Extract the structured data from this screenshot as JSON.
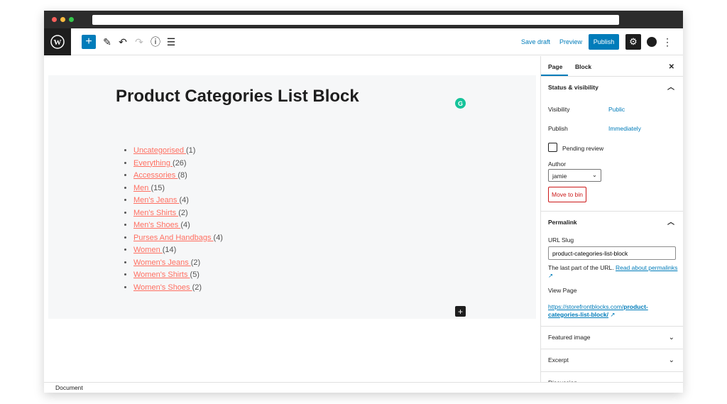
{
  "toolbar": {
    "save_draft": "Save draft",
    "preview": "Preview",
    "publish": "Publish"
  },
  "editor": {
    "title": "Product Categories List Block",
    "grammarly": "G",
    "categories": [
      {
        "name": "Uncategorised ",
        "count": "(1)"
      },
      {
        "name": "Everything ",
        "count": "(26)"
      },
      {
        "name": "Accessories ",
        "count": "(8)"
      },
      {
        "name": "Men ",
        "count": "(15)"
      },
      {
        "name": "Men's Jeans ",
        "count": "(4)"
      },
      {
        "name": "Men's Shirts ",
        "count": "(2)"
      },
      {
        "name": "Men's Shoes ",
        "count": "(4)"
      },
      {
        "name": "Purses And Handbags ",
        "count": "(4)"
      },
      {
        "name": "Women ",
        "count": "(14)"
      },
      {
        "name": "Women's Jeans ",
        "count": "(2)"
      },
      {
        "name": "Women's Shirts ",
        "count": "(5)"
      },
      {
        "name": "Women's Shoes ",
        "count": "(2)"
      }
    ]
  },
  "sidebar": {
    "tabs": [
      "Page",
      "Block"
    ],
    "status": {
      "title": "Status & visibility",
      "visibility_label": "Visibility",
      "visibility_value": "Public",
      "publish_label": "Publish",
      "publish_value": "Immediately",
      "pending": "Pending review",
      "author_label": "Author",
      "author_value": "jamie",
      "move_to_bin": "Move to bin"
    },
    "permalink": {
      "title": "Permalink",
      "slug_label": "URL Slug",
      "slug_value": "product-categories-list-block",
      "help": "The last part of the URL. ",
      "read_about": "Read about permalinks",
      "view_page": "View Page",
      "url_plain": "https://storefrontblocks.com/",
      "url_bold": "product-categories-list-block/"
    },
    "featured": "Featured image",
    "excerpt": "Excerpt",
    "discussion": "Discussion"
  },
  "footer": {
    "breadcrumb": "Document"
  },
  "colors": {
    "accent": "#007cba",
    "link": "#ff6f61",
    "danger": "#cc1818"
  }
}
